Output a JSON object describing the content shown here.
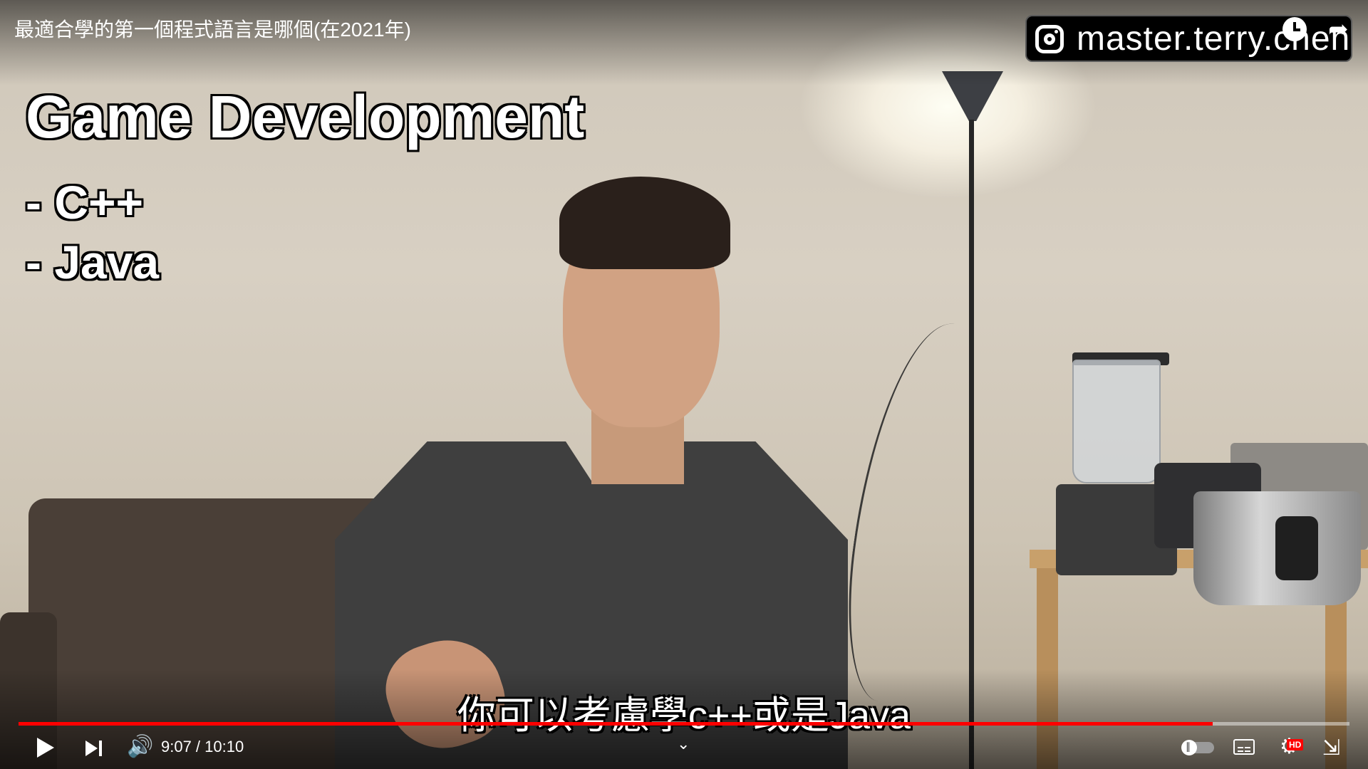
{
  "video": {
    "title": "最適合學的第一個程式語言是哪個(在2021年)",
    "watermark": "master.terry.chen",
    "slide": {
      "heading": "Game Development",
      "items": [
        "- C++",
        "- Java"
      ]
    },
    "caption": "你可以考慮學c++或是Java"
  },
  "player": {
    "current_time": "9:07",
    "duration": "10:10",
    "time_display": "9:07 / 10:10",
    "progress_fraction": 0.897,
    "hd_badge": "HD",
    "icons": {
      "play": "play-icon",
      "next": "next-icon",
      "volume": "volume-icon",
      "chevron": "chevron-down-icon",
      "autoplay": "autoplay-toggle",
      "captions": "captions-icon",
      "settings": "gear-icon",
      "fullscreen": "exit-fullscreen-icon",
      "watch_later": "clock-icon",
      "share": "share-icon"
    },
    "colors": {
      "progress": "#ff0000",
      "hd_badge": "#ff0000"
    }
  }
}
